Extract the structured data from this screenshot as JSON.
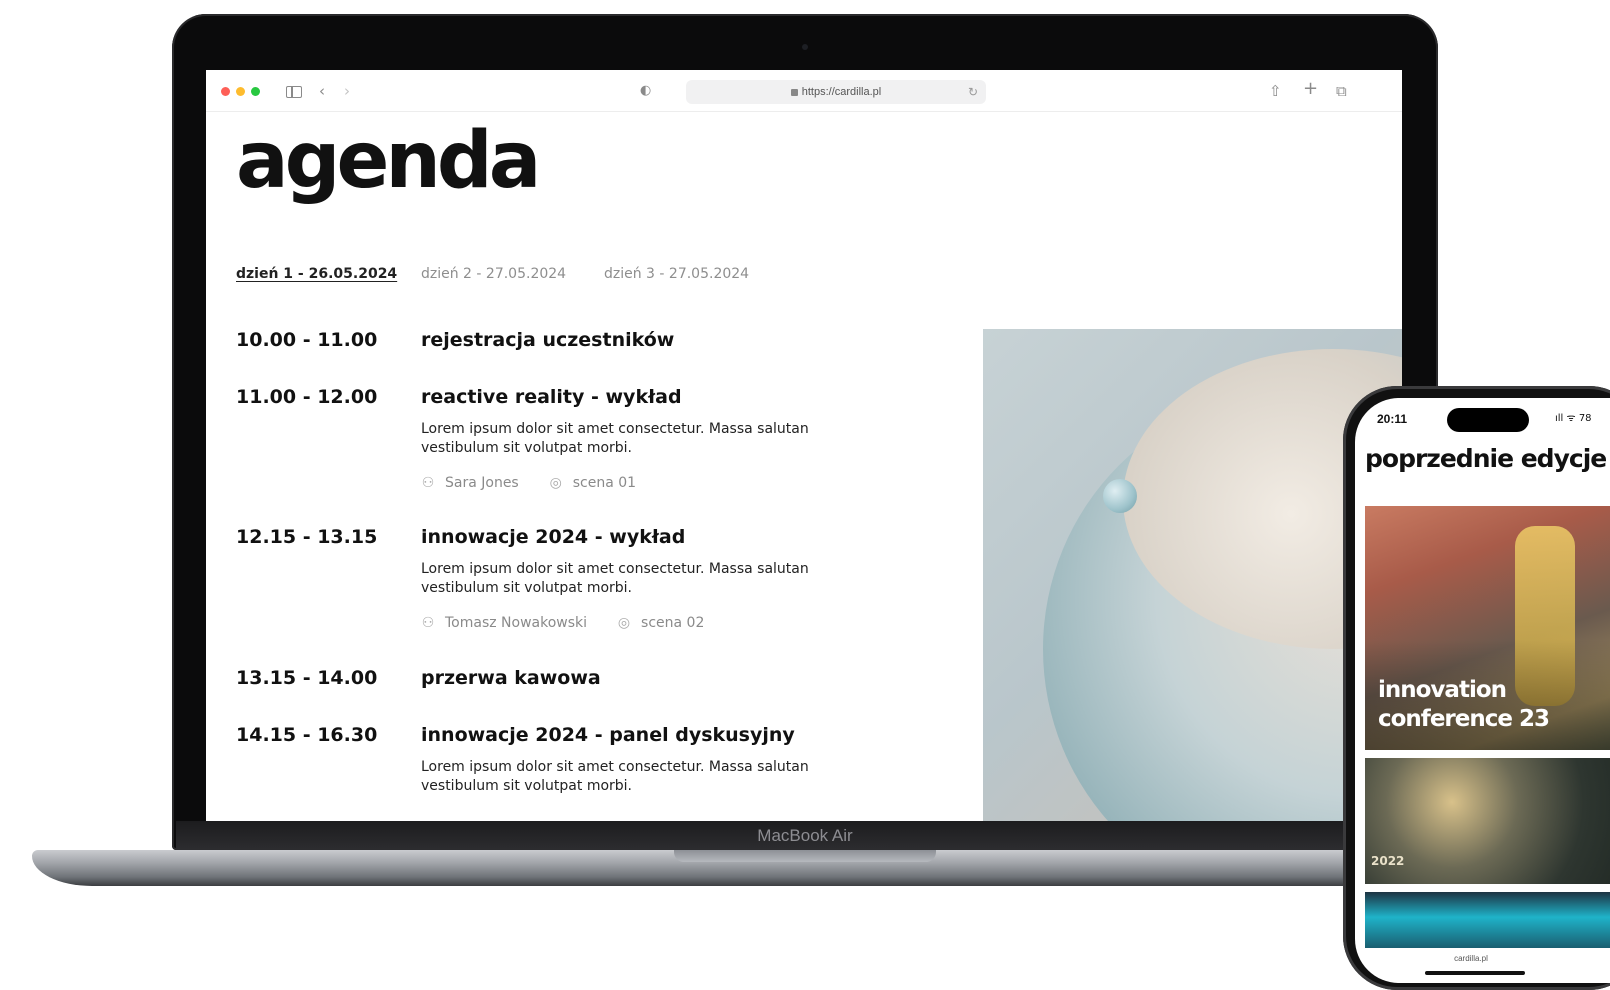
{
  "laptop": {
    "brand": "MacBook Air"
  },
  "browser": {
    "url": "https://cardilla.pl",
    "controls": {
      "back": "‹",
      "forward": "›",
      "share": "⇧",
      "new_tab": "+",
      "tabs": "⧉"
    }
  },
  "page": {
    "title": "agenda",
    "day_tabs": [
      {
        "label": "dzień 1 - 26.05.2024",
        "active": true
      },
      {
        "label": "dzień 2 - 27.05.2024",
        "active": false
      },
      {
        "label": "dzień 3 - 27.05.2024",
        "active": false
      }
    ],
    "slots": [
      {
        "time": "10.00 - 11.00",
        "title": "rejestracja uczestników"
      },
      {
        "time": "11.00 - 12.00",
        "title": "reactive reality - wykład",
        "description": "Lorem ipsum dolor sit amet consectetur. Massa salutan vestibulum sit volutpat morbi.",
        "speaker": "Sara Jones",
        "stage": "scena 01"
      },
      {
        "time": "12.15 - 13.15",
        "title": "innowacje 2024 - wykład",
        "description": "Lorem ipsum dolor sit amet consectetur. Massa salutan vestibulum sit volutpat morbi.",
        "speaker": "Tomasz Nowakowski",
        "stage": "scena 02"
      },
      {
        "time": "13.15 - 14.00",
        "title": "przerwa kawowa"
      },
      {
        "time": "14.15 - 16.30",
        "title": "innowacje 2024 - panel dyskusyjny",
        "description": "Lorem ipsum dolor sit amet consectetur. Massa salutan vestibulum sit volutpat morbi."
      }
    ]
  },
  "phone": {
    "time": "20:11",
    "status": "ıll ᯤ 78",
    "heading": "poprzednie edycje",
    "cards": [
      {
        "title": "innovation conference 23"
      },
      {
        "year": "2022"
      }
    ],
    "url": "cardilla.pl"
  },
  "icons": {
    "person": "person-icon",
    "location": "location-pin-icon",
    "lock": "lock-icon",
    "reload": "reload-icon",
    "shield": "privacy-shield-icon"
  },
  "colors": {
    "traffic_red": "#fe5f57",
    "traffic_yellow": "#febc2e",
    "traffic_green": "#28c840",
    "text": "#111111",
    "muted": "#8e8e8e"
  }
}
